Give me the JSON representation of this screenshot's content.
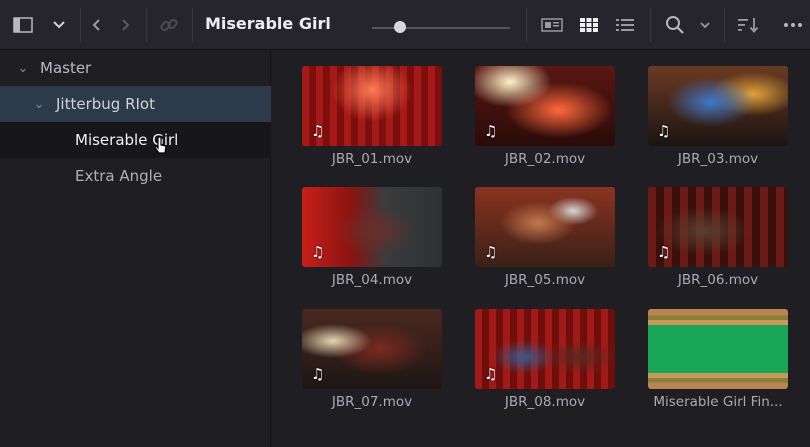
{
  "toolbar": {
    "title": "Miserable Girl",
    "zoom_level": 0.2
  },
  "sidebar": {
    "items": [
      {
        "label": "Master"
      },
      {
        "label": "Jitterbug RIot"
      },
      {
        "label": "Miserable Girl"
      },
      {
        "label": "Extra Angle"
      }
    ]
  },
  "clips": [
    {
      "name": "JBR_01.mov",
      "has_audio": true
    },
    {
      "name": "JBR_02.mov",
      "has_audio": true
    },
    {
      "name": "JBR_03.mov",
      "has_audio": true
    },
    {
      "name": "JBR_04.mov",
      "has_audio": true
    },
    {
      "name": "JBR_05.mov",
      "has_audio": true
    },
    {
      "name": "JBR_06.mov",
      "has_audio": true
    },
    {
      "name": "JBR_07.mov",
      "has_audio": true
    },
    {
      "name": "JBR_08.mov",
      "has_audio": true
    },
    {
      "name": "Miserable Girl Fin...",
      "has_audio": false
    }
  ],
  "colors": {
    "background": "#1f1e23",
    "toolbar": "#26252b",
    "selected_bin_row": "#2d3a49",
    "active_bin_row": "#17161a"
  },
  "icons": {
    "audio": "music-note-icon"
  }
}
